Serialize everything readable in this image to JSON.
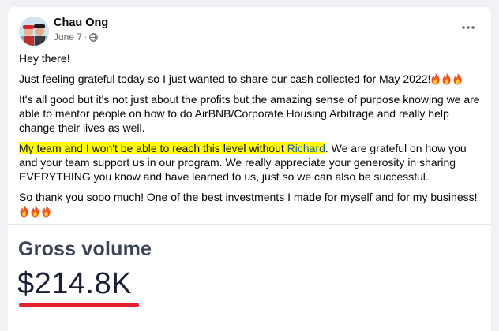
{
  "post": {
    "author": "Chau Ong",
    "date": "June 7",
    "privacy_icon": "globe-icon",
    "more_icon": "more-horizontal-icon",
    "lines": {
      "greeting": "Hey there!",
      "p1": "Just feeling grateful today so I just wanted to share our cash collected for May 2022!",
      "p2": "It's all good but it's not just about the profits but the amazing sense of purpose knowing we are able to mentor people on how to do AirBNB/Corporate Housing Arbitrage and really help change their lives as well.",
      "p3_highlight_a": "My team and I won't be able to reach this level without ",
      "p3_mention": "Richard",
      "p3_rest": ". We are grateful on how you and your team support us in our program. We really appreciate your generosity in sharing EVERYTHING you know and have learned to us, just so we can also be successful.",
      "p4": "So thank you sooo much! One of the best investments I made for myself and for my business!"
    },
    "emoji_icon": "fire-emoji-icon"
  },
  "gross_volume": {
    "title": "Gross volume",
    "amount": "$214.8K"
  },
  "colors": {
    "highlight": "#ffff00",
    "mention": "#1d5ab3",
    "underline": "#e3202b"
  }
}
